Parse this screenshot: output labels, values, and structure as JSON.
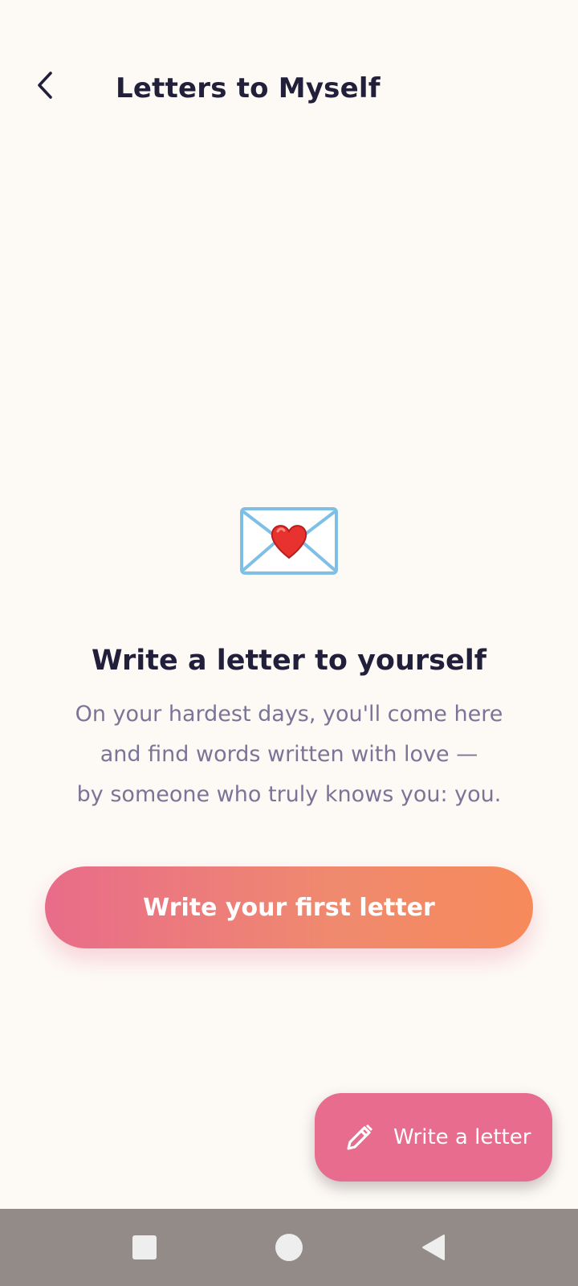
{
  "header": {
    "title": "Letters to Myself",
    "back_icon": "chevron-left-icon"
  },
  "empty_state": {
    "icon": "love-letter-icon",
    "title": "Write a letter to yourself",
    "description_lines": [
      "On your hardest days, you'll come here",
      "and find words written with love —",
      "by someone who truly knows you: you."
    ]
  },
  "primary_action": {
    "label": "Write your first letter"
  },
  "fab": {
    "label": "Write a letter",
    "icon": "pencil-icon"
  },
  "system_nav": {
    "recents_icon": "recents-square-icon",
    "home_icon": "home-circle-icon",
    "back_icon": "back-triangle-icon"
  },
  "colors": {
    "background": "#fdfaf6",
    "title_text": "#221f3b",
    "muted_text": "#7a7496",
    "gradient_start": "#e86c8a",
    "gradient_end": "#f68a5a",
    "fab": "#e86c8e",
    "nav_bar": "#938b87"
  }
}
